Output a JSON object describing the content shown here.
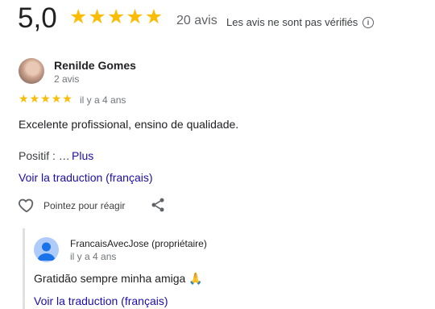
{
  "summary": {
    "rating": "5,0",
    "stars": [
      "★",
      "★",
      "★",
      "★",
      "★"
    ],
    "count": "20 avis",
    "note": "Les avis ne sont pas vérifiés",
    "info_icon": "info-icon"
  },
  "review": {
    "author": "Renilde Gomes",
    "author_meta": "2 avis",
    "stars": [
      "★",
      "★",
      "★",
      "★",
      "★"
    ],
    "time": "il y a 4 ans",
    "text": "Excelente profissional, ensino de qualidade.",
    "positive_label": "Positif : …",
    "more_label": "Plus",
    "translate_label": "Voir la traduction (français)",
    "react_label": "Pointez pour réagir",
    "icons": [
      "heart-icon",
      "share-icon"
    ]
  },
  "reply": {
    "author": "FrancaisAvecJose (propriétaire)",
    "time": "il y a 4 ans",
    "text": "Gratidão sempre minha amiga 🙏",
    "translate_label": "Voir la traduction (français)"
  },
  "colors": {
    "star": "#fbbc04",
    "link": "#1a0dab"
  }
}
